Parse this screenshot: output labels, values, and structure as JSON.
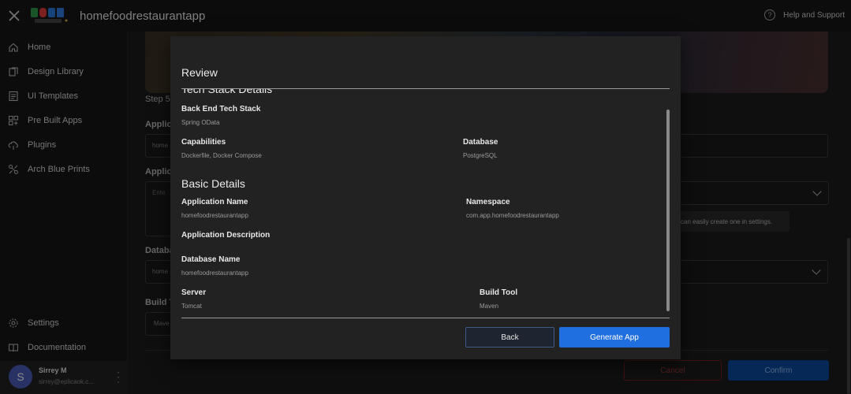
{
  "header": {
    "app_name": "homefoodrestaurantapp",
    "help_label": "Help and Support"
  },
  "sidebar": {
    "items": [
      {
        "label": "Home",
        "icon": "home-icon"
      },
      {
        "label": "Design Library",
        "icon": "design-library-icon"
      },
      {
        "label": "UI Templates",
        "icon": "ui-templates-icon"
      },
      {
        "label": "Pre Built Apps",
        "icon": "grid-plus-icon"
      },
      {
        "label": "Plugins",
        "icon": "cloud-plug-icon"
      },
      {
        "label": "Arch Blue Prints",
        "icon": "blueprint-icon"
      }
    ],
    "bottom_items": [
      {
        "label": "Settings",
        "icon": "gear-icon"
      },
      {
        "label": "Documentation",
        "icon": "book-icon"
      }
    ],
    "user": {
      "initial": "S",
      "name": "Sirrey M",
      "email": "sirrey@eplicaok.c..."
    }
  },
  "background": {
    "step_label": "Step 5",
    "label_app": "Applic",
    "field_app_value": "home",
    "label_desc": "Applic",
    "field_desc_placeholder": "Ente",
    "label_db": "Databa",
    "field_db_value": "home",
    "label_build": "Build T",
    "field_build_value": "Mave",
    "hint_text": "can easily create one in settings.",
    "cancel_label": "Cancel",
    "confirm_label": "Confirm"
  },
  "modal": {
    "title": "Review",
    "tech_stack": {
      "section_title": "Tech Stack Details",
      "backend_label": "Back End Tech Stack",
      "backend_value": "Spring OData",
      "capabilities_label": "Capabilities",
      "capabilities_value": "Dockerfile, Docker Compose",
      "database_label": "Database",
      "database_value": "PostgreSQL"
    },
    "basic": {
      "section_title": "Basic Details",
      "app_name_label": "Application Name",
      "app_name_value": "homefoodrestaurantapp",
      "namespace_label": "Namespace",
      "namespace_value": "com.app.homefoodrestaurantapp",
      "app_desc_label": "Application Description",
      "app_desc_value": "",
      "db_name_label": "Database Name",
      "db_name_value": "homefoodrestaurantapp",
      "server_label": "Server",
      "server_value": "Tomcat",
      "build_tool_label": "Build Tool",
      "build_tool_value": "Maven"
    },
    "back_label": "Back",
    "generate_label": "Generate App"
  },
  "colors": {
    "primary": "#1f6fe0",
    "avatar": "#4a5bb8",
    "danger": "#7a1f1f"
  }
}
